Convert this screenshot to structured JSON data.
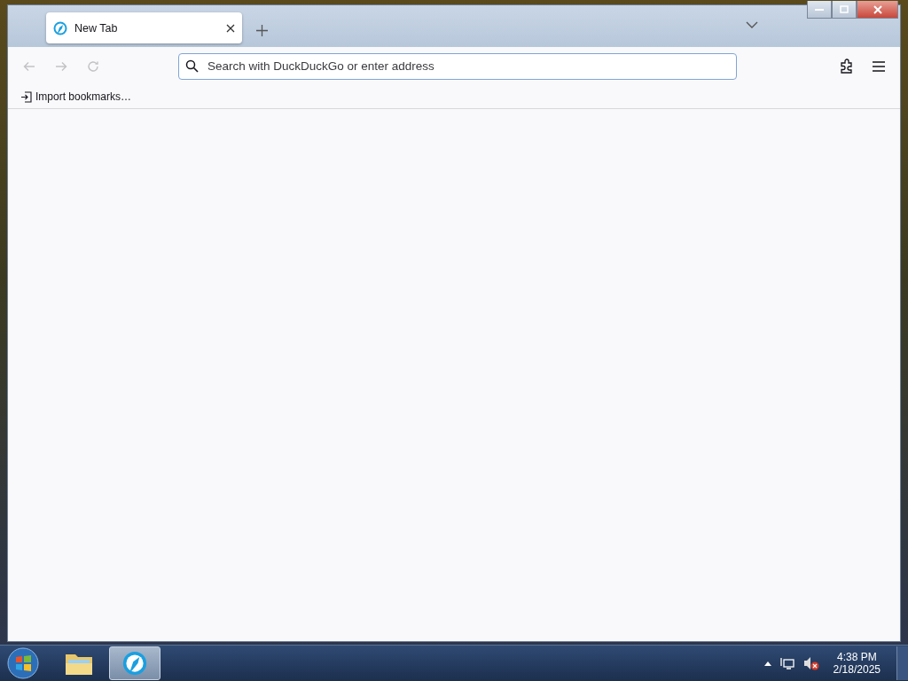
{
  "tabs": [
    {
      "title": "New Tab",
      "selected": true
    }
  ],
  "toolbar": {
    "nav": [
      {
        "kind": "back",
        "disabled": true
      },
      {
        "kind": "forward",
        "disabled": true
      },
      {
        "kind": "reload",
        "disabled": true
      }
    ],
    "address": {
      "placeholder": "Search with DuckDuckGo or enter address"
    }
  },
  "bookmarks": [
    {
      "label": "Import bookmarks…"
    }
  ],
  "taskbar": {
    "apps": [
      {
        "kind": "folder",
        "selected": false
      },
      {
        "kind": "browser",
        "selected": true
      }
    ],
    "clock": {
      "time": "4:38 PM",
      "date": "2/18/2025"
    }
  }
}
